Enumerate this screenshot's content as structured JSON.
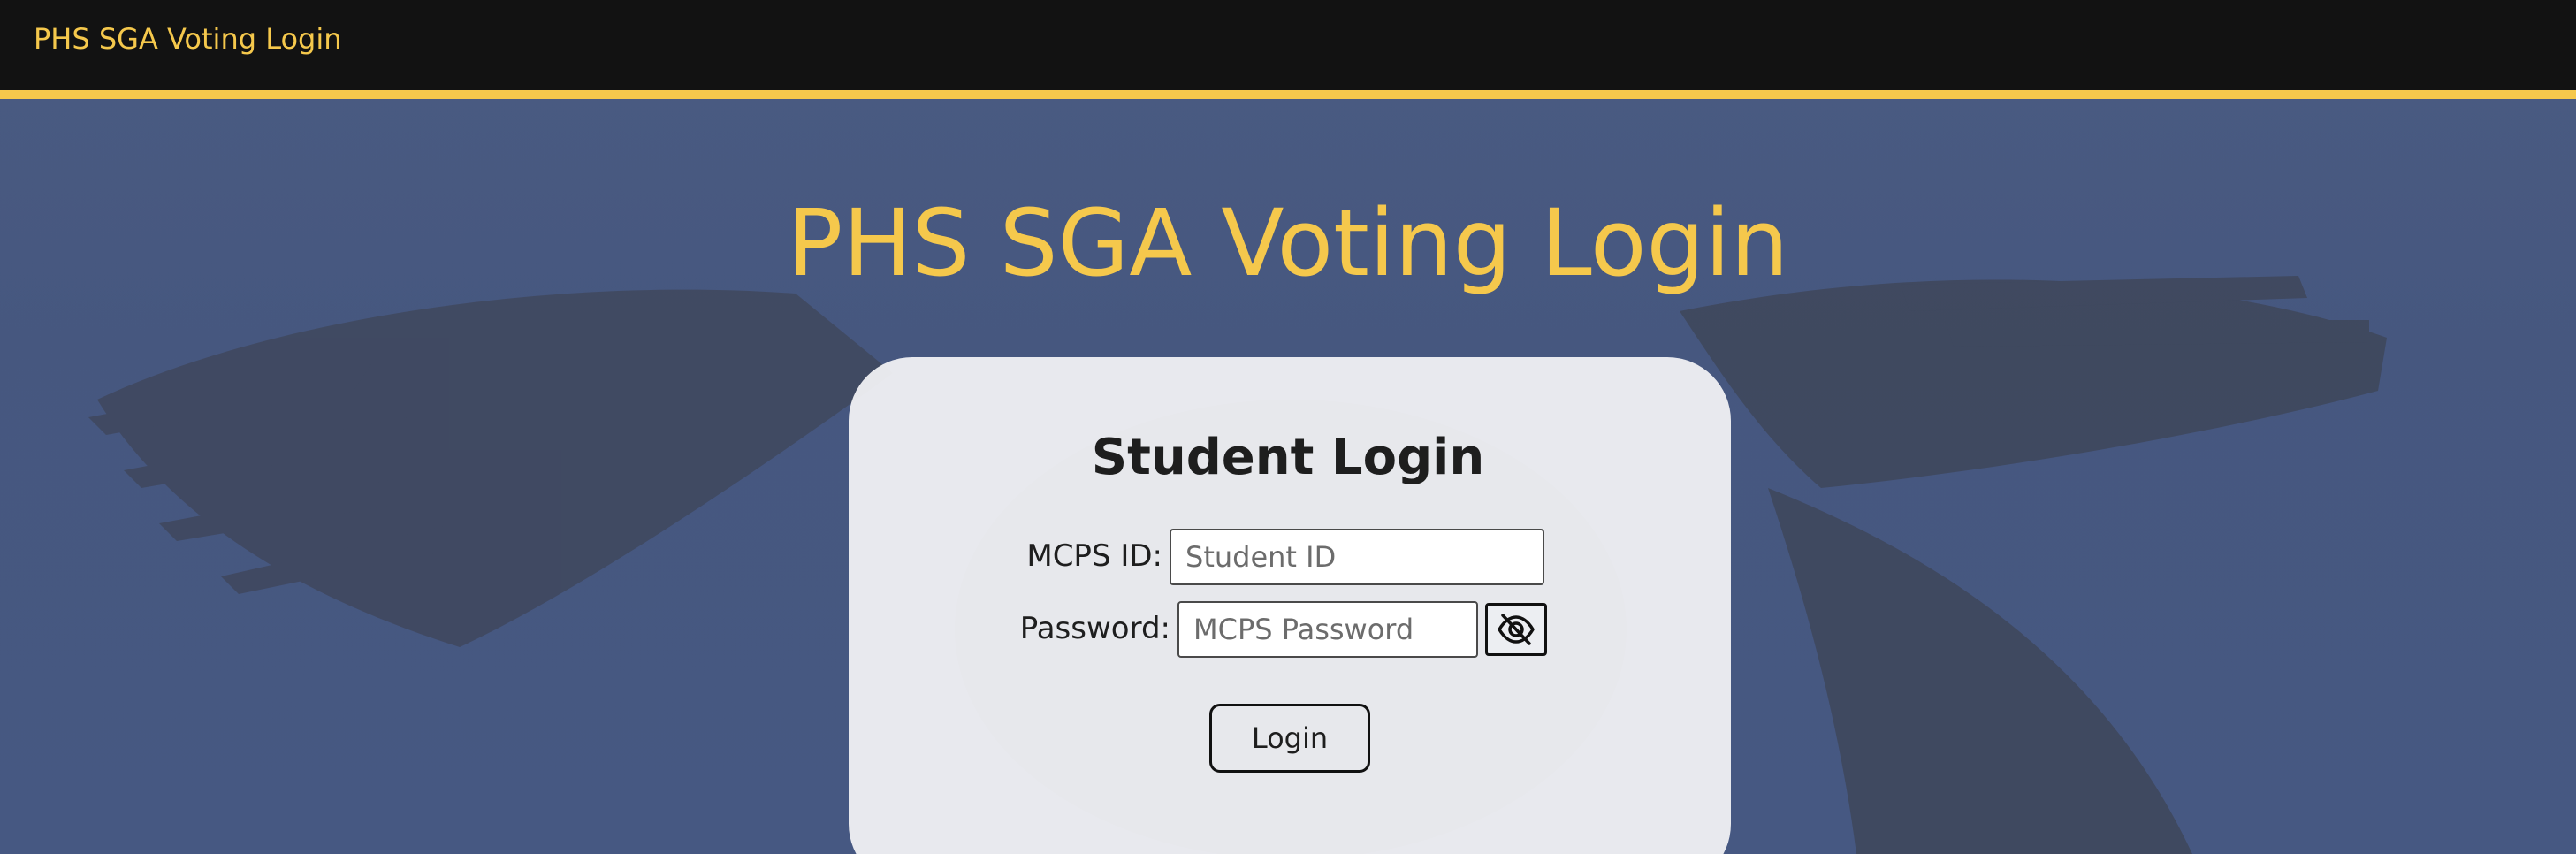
{
  "header": {
    "brand": "PHS SGA Voting Login"
  },
  "hero": {
    "title": "PHS SGA Voting Login"
  },
  "login_card": {
    "title": "Student Login",
    "id_label": "MCPS ID:",
    "id_placeholder": "Student ID",
    "id_value": "",
    "password_label": "Password:",
    "password_placeholder": "MCPS Password",
    "password_value": "",
    "toggle_icon": "eye-slash-icon",
    "submit_label": "Login"
  },
  "colors": {
    "accent": "#f5c84c",
    "header_bg": "#121212",
    "page_bg": "#485a82",
    "card_bg": "#f4f4f6",
    "text": "#1e1e1e"
  }
}
